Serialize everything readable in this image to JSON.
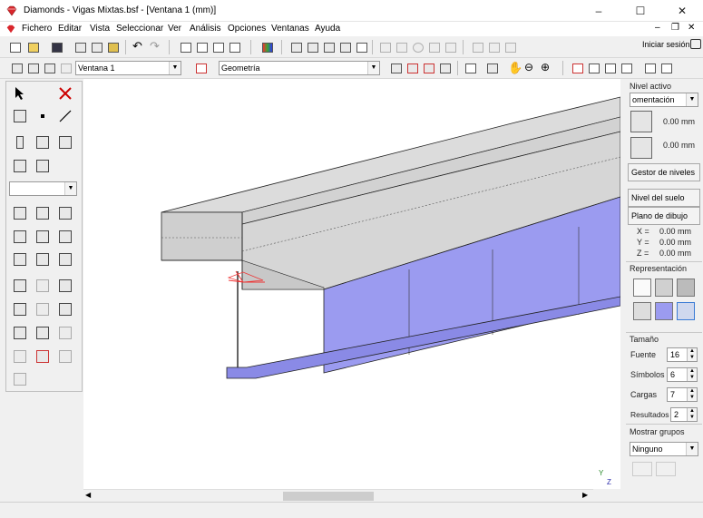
{
  "window": {
    "title": "Diamonds - Vigas Mixtas.bsf - [Ventana 1 (mm)]",
    "minimize": "–",
    "maximize": "☐",
    "close": "✕",
    "mdi_min": "–",
    "mdi_restore": "❐",
    "mdi_close": "✕"
  },
  "menu": [
    "Fichero",
    "Editar",
    "Vista",
    "Seleccionar",
    "Ver",
    "Análisis",
    "Opciones",
    "Ventanas",
    "Ayuda"
  ],
  "toolbar": {
    "signin_label": "Iniciar sesión"
  },
  "toolbar2": {
    "window_select": "Ventana 1",
    "view_select": "Geometría"
  },
  "left_panel": {
    "combo_value": ""
  },
  "right_panel": {
    "nivel_activo_label": "Nivel activo",
    "nivel_value": "omentación",
    "level_offset_top": "0.00 mm",
    "level_offset_bottom": "0.00 mm",
    "gestor_label": "Gestor de niveles",
    "nivel_suelo_label": "Nivel del suelo",
    "plano_dibujo_label": "Plano de dibujo",
    "coords": [
      {
        "axis": "X =",
        "value": "0.00 mm"
      },
      {
        "axis": "Y =",
        "value": "0.00 mm"
      },
      {
        "axis": "Z =",
        "value": "0.00 mm"
      }
    ],
    "representacion_label": "Representación",
    "tamano_label": "Tamaño",
    "sizes": [
      {
        "label": "Fuente",
        "value": "16"
      },
      {
        "label": "Símbolos",
        "value": "6"
      },
      {
        "label": "Cargas",
        "value": "7"
      },
      {
        "label": "Resultados",
        "value": "2"
      }
    ],
    "mostrar_grupos_label": "Mostrar grupos",
    "grupos_value": "Ninguno"
  },
  "viewport": {
    "axis_y": "Y",
    "axis_z": "Z"
  },
  "colors": {
    "slab": "#d8d8d8",
    "web": "#9b9bf0",
    "flange": "#8a8ae6"
  }
}
